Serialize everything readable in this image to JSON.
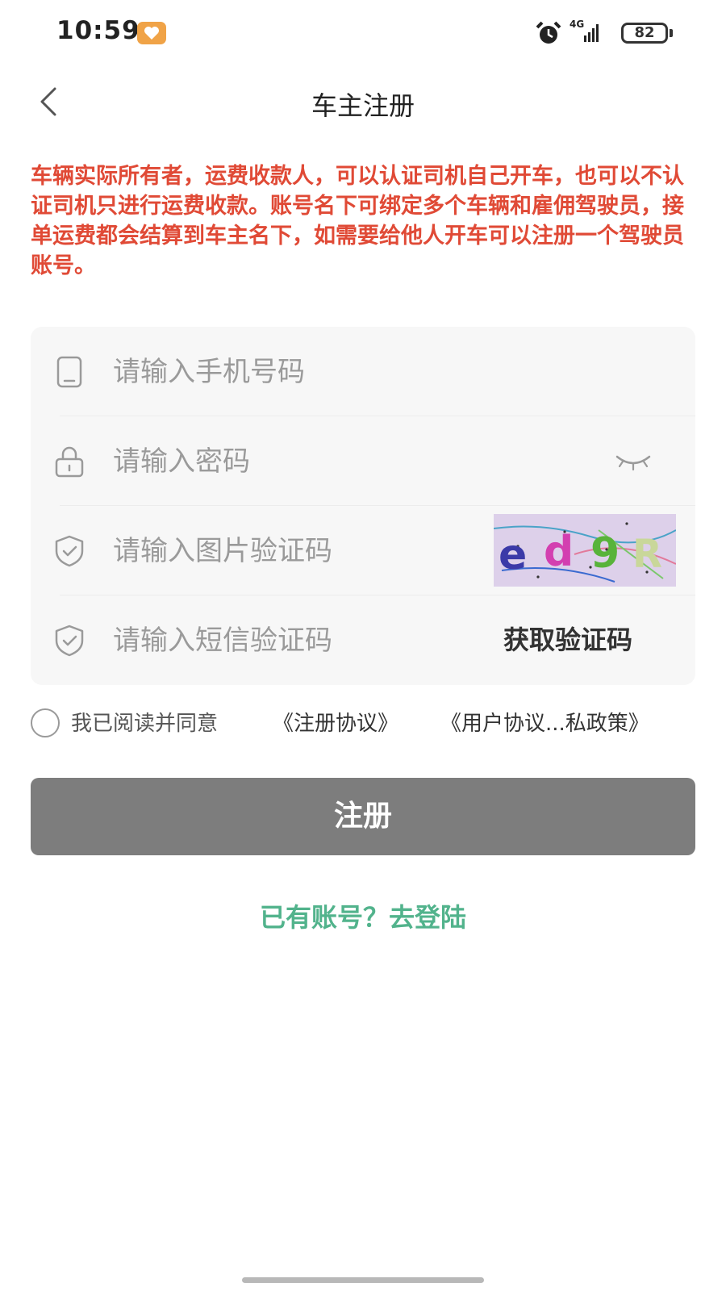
{
  "status_bar": {
    "time": "10:59",
    "network": "4G",
    "battery": "82"
  },
  "nav": {
    "title": "车主注册"
  },
  "notice": {
    "text": "车辆实际所有者，运费收款人，可以认证司机自己开车，也可以不认证司机只进行运费收款。账号名下可绑定多个车辆和雇佣驾驶员，接单运费都会结算到车主名下，如需要给他人开车可以注册一个驾驶员账号。",
    "color": "#e04a36"
  },
  "form": {
    "phone": {
      "placeholder": "请输入手机号码",
      "value": ""
    },
    "password": {
      "placeholder": "请输入密码",
      "value": ""
    },
    "captcha": {
      "placeholder": "请输入图片验证码",
      "value": "",
      "image_text": [
        "e",
        "d",
        "9",
        "R"
      ]
    },
    "sms": {
      "placeholder": "请输入短信验证码",
      "value": "",
      "get_code_label": "获取验证码"
    }
  },
  "agreement": {
    "checked": false,
    "text": "我已阅读并同意",
    "link_register": "《注册协议》",
    "link_privacy": "《用户协议...私政策》"
  },
  "register_button": {
    "label": "注册",
    "color": "#7d7d7d"
  },
  "login_link": {
    "label": "已有账号？去登陆",
    "color": "#52b38c"
  }
}
